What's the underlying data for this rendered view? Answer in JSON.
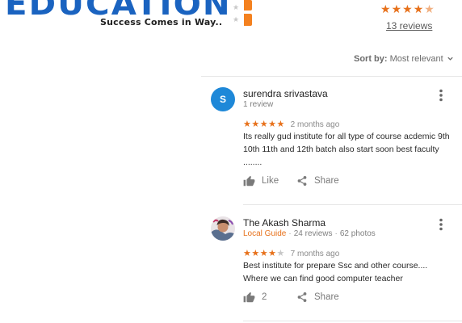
{
  "header": {
    "logo_text": "EDUCATION",
    "tagline": "Success Comes in Way.."
  },
  "summary": {
    "rating": 4.5,
    "reviews_link": "13 reviews"
  },
  "sort": {
    "label": "Sort by:",
    "value": "Most relevant"
  },
  "reviews": [
    {
      "author": "surendra srivastava",
      "avatar_letter": "S",
      "avatar_color": "#1e88d8",
      "meta": "1 review",
      "rating": 5,
      "time": "2 months ago",
      "text": "Its  really gud institute for all type of course acdemic 9th 10th 11th and 12th batch also start soon best faculty ........",
      "like_label": "Like",
      "share_label": "Share"
    },
    {
      "author": "The Akash Sharma",
      "badge": "Local Guide",
      "review_count": "24 reviews",
      "photo_count": "62 photos",
      "rating": 4,
      "time": "7 months ago",
      "text": "Best institute for prepare Ssc and other course.... Where we can find good computer teacher",
      "like_count": "2",
      "share_label": "Share"
    }
  ],
  "colors": {
    "logo_blue": "#1a63c0",
    "accent_orange": "#e7711b",
    "avatar_blue": "#1e88d8"
  }
}
